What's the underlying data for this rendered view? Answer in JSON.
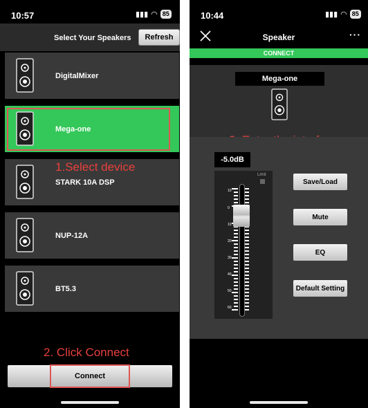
{
  "left_screen": {
    "status": {
      "time": "10:57",
      "battery": "85"
    },
    "header": {
      "title": "Select Your Speakers",
      "refresh_label": "Refresh"
    },
    "devices": [
      {
        "label": "DigitalMixer",
        "selected": false
      },
      {
        "label": "Mega-one",
        "selected": true
      },
      {
        "label": "STARK 10A DSP",
        "selected": false
      },
      {
        "label": "NUP-12A",
        "selected": false
      },
      {
        "label": "BT5.3",
        "selected": false
      }
    ],
    "annotations": {
      "step1": "1.Select device",
      "step2": "2. Click Connect"
    },
    "connect_label": "Connect"
  },
  "right_screen": {
    "status": {
      "time": "10:44",
      "battery": "85"
    },
    "header": {
      "title": "Speaker",
      "more": "···"
    },
    "connection_status": "CONNECT",
    "device_name": "Mega-one",
    "annotation": "3. Enter the interface",
    "gain_value": "-5.0dB",
    "limit_label": "Limit",
    "fader_scale": [
      "10",
      "0",
      "10",
      "20",
      "30",
      "40",
      "50",
      "60"
    ],
    "buttons": {
      "save_load": "Save/Load",
      "mute": "Mute",
      "eq": "EQ",
      "default_setting": "Default Setting"
    }
  },
  "colors": {
    "selected_green": "#34c759",
    "annotation_red": "#e8403c"
  }
}
